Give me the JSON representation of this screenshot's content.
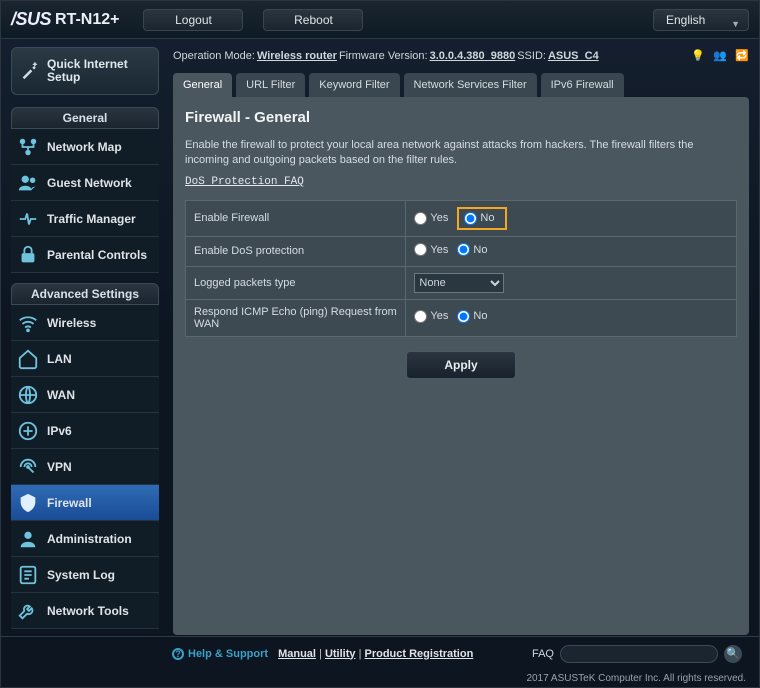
{
  "header": {
    "brand": "/SUS",
    "model": "RT-N12+",
    "logout": "Logout",
    "reboot": "Reboot",
    "language": "English"
  },
  "status": {
    "op_mode_label": "Operation Mode: ",
    "op_mode": "Wireless router",
    "fw_label": "  Firmware Version: ",
    "fw": "3.0.0.4.380_9880",
    "ssid_label": "  SSID: ",
    "ssid": "ASUS_C4"
  },
  "qis_label": "Quick Internet Setup",
  "sidebar": {
    "general_head": "General",
    "general": [
      {
        "label": "Network Map"
      },
      {
        "label": "Guest Network"
      },
      {
        "label": "Traffic Manager"
      },
      {
        "label": "Parental Controls"
      }
    ],
    "adv_head": "Advanced Settings",
    "adv": [
      {
        "label": "Wireless"
      },
      {
        "label": "LAN"
      },
      {
        "label": "WAN"
      },
      {
        "label": "IPv6"
      },
      {
        "label": "VPN"
      },
      {
        "label": "Firewall"
      },
      {
        "label": "Administration"
      },
      {
        "label": "System Log"
      },
      {
        "label": "Network Tools"
      }
    ]
  },
  "tabs": [
    "General",
    "URL Filter",
    "Keyword Filter",
    "Network Services Filter",
    "IPv6 Firewall"
  ],
  "panel": {
    "title": "Firewall - General",
    "desc": "Enable the firewall to protect your local area network against attacks from hackers. The firewall filters the incoming and outgoing packets based on the filter rules.",
    "faq": "DoS Protection FAQ",
    "rows": {
      "r0": "Enable Firewall",
      "r1": "Enable DoS protection",
      "r2": "Logged packets type",
      "r3": "Respond ICMP Echo (ping) Request from WAN"
    },
    "yes": "Yes",
    "no": "No",
    "logged_value": "None",
    "apply": "Apply"
  },
  "footer": {
    "help": "Help & Support",
    "manual": "Manual",
    "utility": "Utility",
    "product_reg": "Product Registration",
    "faq": "FAQ",
    "copyright": "2017 ASUSTeK Computer Inc. All rights reserved."
  }
}
